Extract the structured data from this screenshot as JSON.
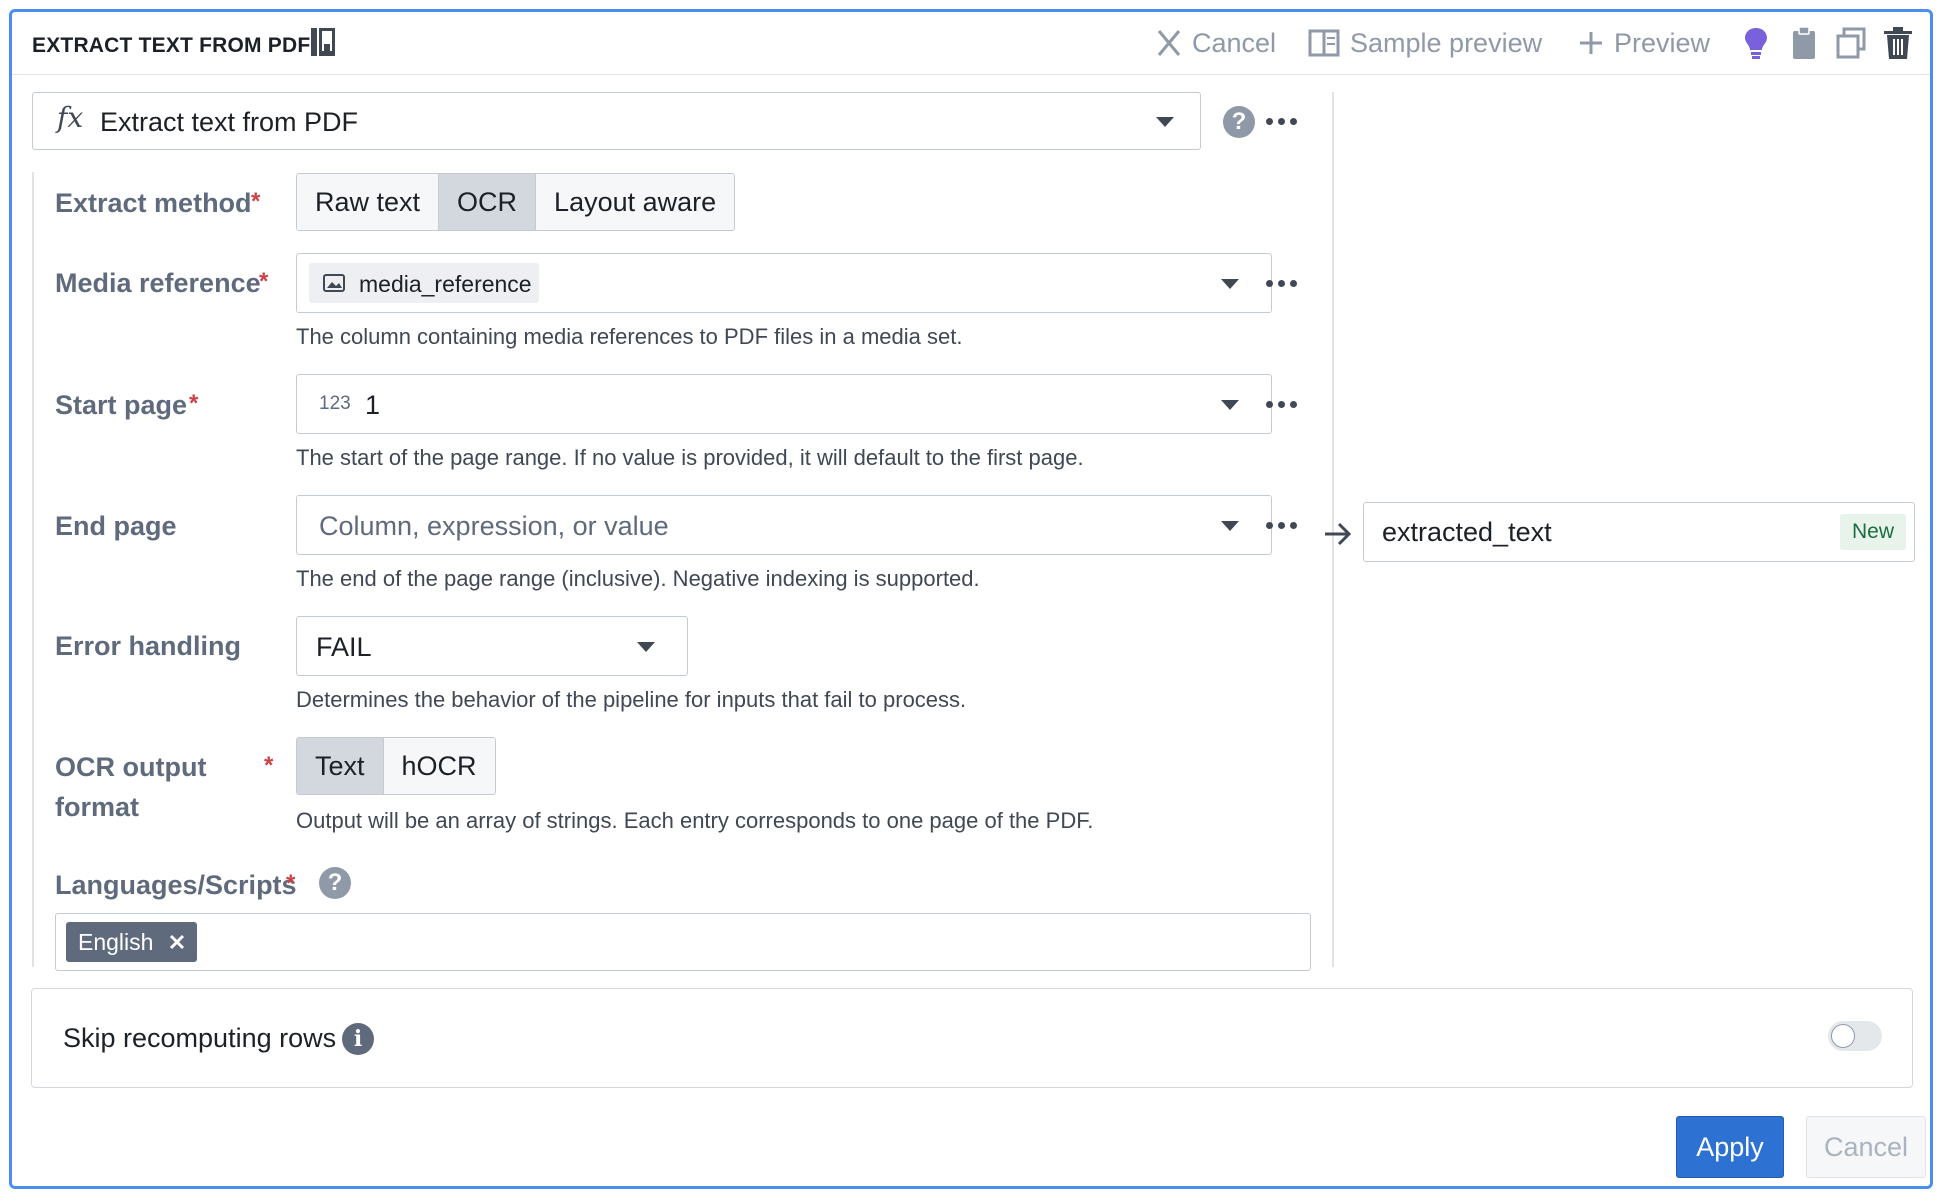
{
  "header": {
    "title": "EXTRACT TEXT FROM PDF",
    "cancel_label": "Cancel",
    "sample_preview_label": "Sample preview",
    "preview_label": "Preview"
  },
  "function": {
    "fx": "fx",
    "name": "Extract text from PDF"
  },
  "fields": {
    "extract_method": {
      "label": "Extract method",
      "required": "*",
      "options": [
        "Raw text",
        "OCR",
        "Layout aware"
      ],
      "selected": "OCR"
    },
    "media_reference": {
      "label": "Media reference",
      "required": "*",
      "value": "media_reference",
      "help": "The column containing media references to PDF files in a media set."
    },
    "start_page": {
      "label": "Start page",
      "required": "*",
      "type_badge": "123",
      "value": "1",
      "help": "The start of the page range. If no value is provided, it will default to the first page."
    },
    "end_page": {
      "label": "End page",
      "placeholder": "Column, expression, or value",
      "help": "The end of the page range (inclusive). Negative indexing is supported."
    },
    "error_handling": {
      "label": "Error handling",
      "value": "FAIL",
      "help": "Determines the behavior of the pipeline for inputs that fail to process."
    },
    "ocr_output_format": {
      "label_line1": "OCR output",
      "label_line2": "format",
      "required": "*",
      "options": [
        "Text",
        "hOCR"
      ],
      "selected": "Text",
      "help": "Output will be an array of strings. Each entry corresponds to one page of the PDF."
    },
    "languages": {
      "label": "Languages/Scripts",
      "required": "*",
      "tags": [
        "English"
      ]
    }
  },
  "output": {
    "column_name": "extracted_text",
    "badge": "New"
  },
  "skip_recomputing": {
    "label": "Skip recomputing rows",
    "enabled": false
  },
  "footer": {
    "apply_label": "Apply",
    "cancel_label": "Cancel"
  },
  "colors": {
    "accent": "#2d72d2",
    "frame": "#4a8ef0",
    "required": "#cd4246",
    "lightbulb": "#7961db"
  }
}
